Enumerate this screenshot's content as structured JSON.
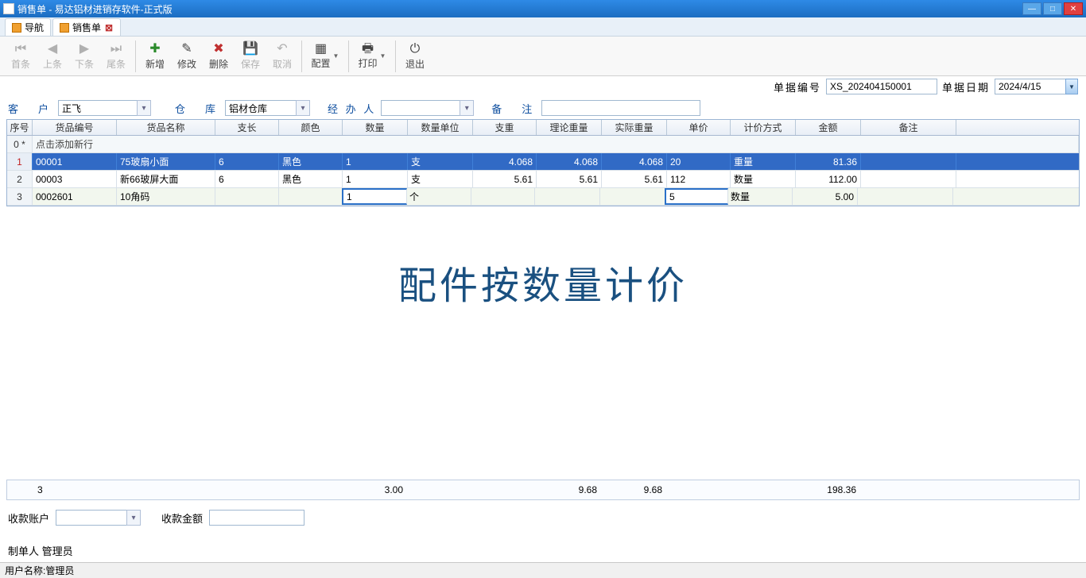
{
  "window": {
    "title": "销售单 - 易达铝材进销存软件-正式版"
  },
  "tabs": [
    {
      "label": "导航"
    },
    {
      "label": "销售单"
    }
  ],
  "toolbar": {
    "first": "首条",
    "prev": "上条",
    "next": "下条",
    "last": "尾条",
    "add": "新增",
    "edit": "修改",
    "delete": "删除",
    "save": "保存",
    "cancel": "取消",
    "config": "配置",
    "print": "打印",
    "exit": "退出"
  },
  "docinfo": {
    "doc_no_label": "单据编号",
    "doc_no": "XS_202404150001",
    "doc_date_label": "单据日期",
    "doc_date": "2024/4/15"
  },
  "form": {
    "customer_label": "客　户",
    "customer": "正飞",
    "warehouse_label": "仓　库",
    "warehouse": "铝材仓库",
    "handler_label": "经 办 人",
    "handler": "",
    "remark_label": "备　注",
    "remark": ""
  },
  "grid": {
    "headers": {
      "idx": "序号",
      "code": "货品编号",
      "name": "货品名称",
      "len": "支长",
      "color": "颜色",
      "qty": "数量",
      "unit": "数量单位",
      "uw": "支重",
      "tw": "理论重量",
      "aw": "实际重量",
      "price": "单价",
      "pm": "计价方式",
      "amt": "金额",
      "rem": "备注"
    },
    "addrow_label": "点击添加新行",
    "rows": [
      {
        "idx": "1",
        "code": "00001",
        "name": "75玻扇小面",
        "len": "6",
        "color": "黑色",
        "qty": "1",
        "unit": "支",
        "uw": "4.068",
        "tw": "4.068",
        "aw": "4.068",
        "price": "20",
        "pm": "重量",
        "amt": "81.36",
        "rem": ""
      },
      {
        "idx": "2",
        "code": "00003",
        "name": "新66玻屏大面",
        "len": "6",
        "color": "黑色",
        "qty": "1",
        "unit": "支",
        "uw": "5.61",
        "tw": "5.61",
        "aw": "5.61",
        "price": "112",
        "pm": "数量",
        "amt": "112.00",
        "rem": ""
      },
      {
        "idx": "3",
        "code": "0002601",
        "name": "10角码",
        "len": "",
        "color": "",
        "qty": "1",
        "unit": "个",
        "uw": "",
        "tw": "",
        "aw": "",
        "price": "5",
        "pm": "数量",
        "amt": "5.00",
        "rem": ""
      }
    ],
    "totals": {
      "qty": "3",
      "sum_qty": "3.00",
      "tw": "9.68",
      "aw": "9.68",
      "amt": "198.36"
    }
  },
  "overlay": "配件按数量计价",
  "payment": {
    "account_label": "收款账户",
    "account": "",
    "amount_label": "收款金额",
    "amount": ""
  },
  "maker": {
    "label": "制单人",
    "value": "管理员"
  },
  "statusbar": {
    "user_label": "用户名称:",
    "user": "管理员"
  }
}
